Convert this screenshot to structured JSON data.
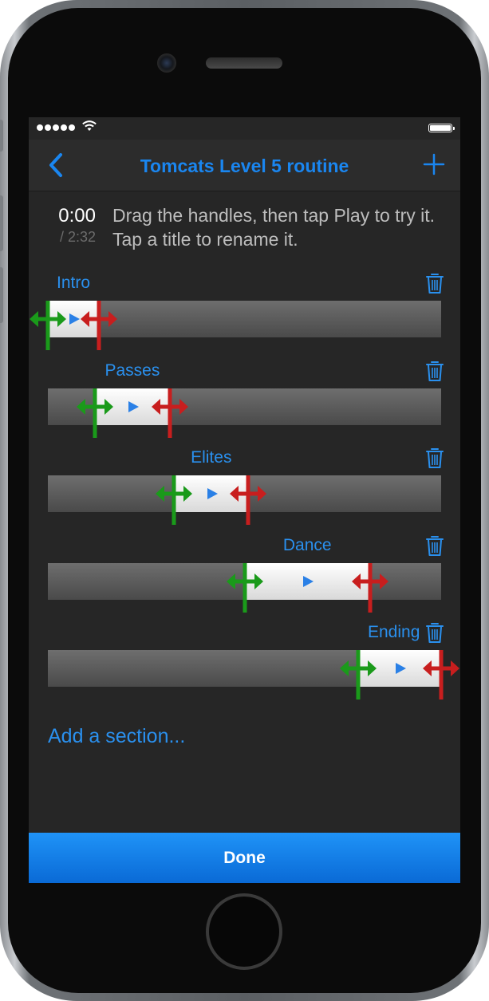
{
  "nav": {
    "title": "Tomcats Level 5 routine",
    "back_icon": "chevron-left-icon",
    "add_icon": "plus-icon"
  },
  "timer": {
    "current": "0:00",
    "total": "/ 2:32"
  },
  "instructions": "Drag the handles, then tap Play to try it. Tap a title to rename it.",
  "sections": [
    {
      "title": "Intro",
      "start_fraction": 0.0,
      "end_fraction": 0.13
    },
    {
      "title": "Passes",
      "start_fraction": 0.12,
      "end_fraction": 0.31
    },
    {
      "title": "Elites",
      "start_fraction": 0.32,
      "end_fraction": 0.51
    },
    {
      "title": "Dance",
      "start_fraction": 0.5,
      "end_fraction": 0.82
    },
    {
      "title": "Ending",
      "start_fraction": 0.79,
      "end_fraction": 1.0
    }
  ],
  "add_section_label": "Add a section...",
  "done_label": "Done",
  "colors": {
    "accent": "#1a86f0",
    "start_handle": "#1a9a1a",
    "end_handle": "#c81e1e",
    "screen_bg": "#262626"
  }
}
